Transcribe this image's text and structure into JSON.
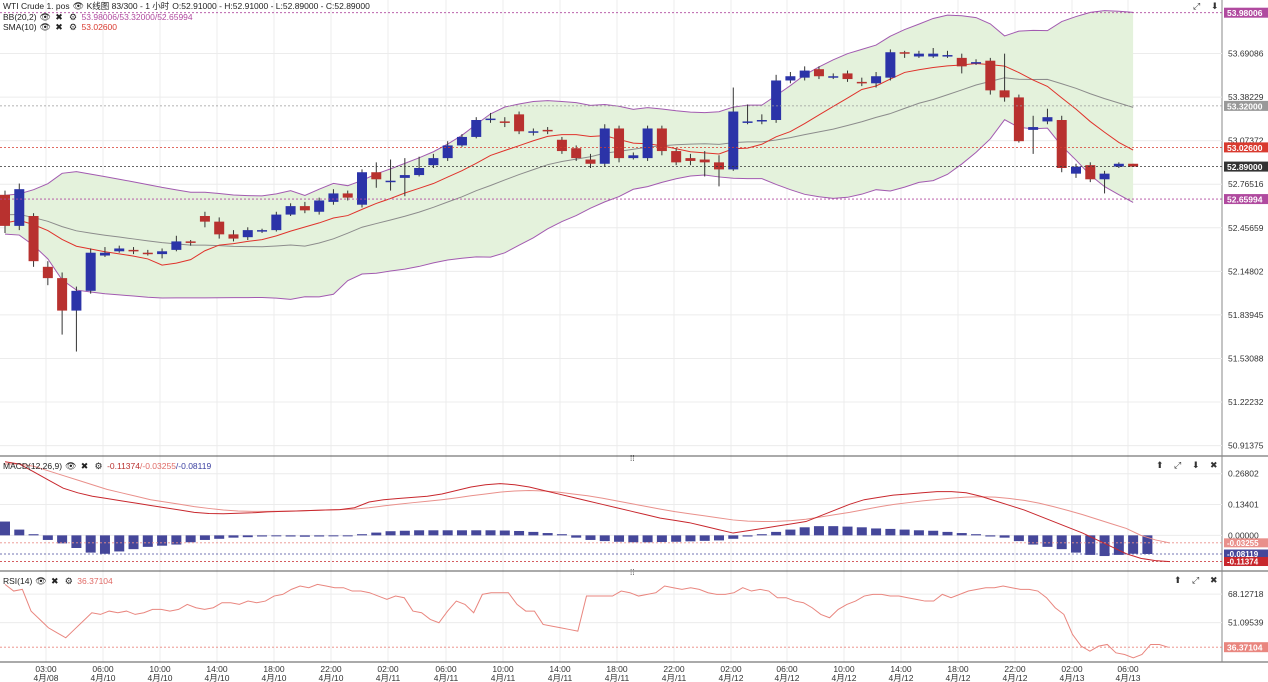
{
  "header": {
    "instrument": "WTI Crude 1. pos",
    "chart_label": "K线图 83/300 - 1 小时",
    "ohlc": "O:52.91000 - H:52.91000 - L:52.89000 - C:52.89000"
  },
  "indicators": {
    "bb": {
      "name": "BB(20,2)",
      "values_upper_mid": "53.98006/53.32000/",
      "values_lower": "52.65994"
    },
    "sma": {
      "name": "SMA(10)",
      "value": "53.02600"
    },
    "macd": {
      "name": "MACD(12,26,9)",
      "v1": "-0.11374",
      "v2": "/-0.03255",
      "v3": "/-0.08119"
    },
    "rsi": {
      "name": "RSI(14)",
      "value": "36.37104"
    }
  },
  "icons": {
    "eye": "eye-icon",
    "close": "close-icon",
    "gear": "gear-icon",
    "up": "arrow-up-icon",
    "expand": "expand-icon",
    "down": "arrow-down-icon",
    "splitter": "drag-handle-icon"
  },
  "colors": {
    "bull": "#2b33a8",
    "bear": "#b8312f",
    "band_fill": "#e4f2dc",
    "band_line": "#a25ab0",
    "sma": "#e0322b",
    "bb_mid": "#8c8c8c",
    "price_line": "#333333"
  },
  "chart_data": [
    {
      "type": "candlestick",
      "x_labels": [
        {
          "time": "03:00",
          "date": "4月/08"
        },
        {
          "time": "06:00",
          "date": "4月/10"
        },
        {
          "time": "10:00",
          "date": "4月/10"
        },
        {
          "time": "14:00",
          "date": "4月/10"
        },
        {
          "time": "18:00",
          "date": "4月/10"
        },
        {
          "time": "22:00",
          "date": "4月/10"
        },
        {
          "time": "02:00",
          "date": "4月/11"
        },
        {
          "time": "06:00",
          "date": "4月/11"
        },
        {
          "time": "10:00",
          "date": "4月/11"
        },
        {
          "time": "14:00",
          "date": "4月/11"
        },
        {
          "time": "18:00",
          "date": "4月/11"
        },
        {
          "time": "22:00",
          "date": "4月/11"
        },
        {
          "time": "02:00",
          "date": "4月/12"
        },
        {
          "time": "06:00",
          "date": "4月/12"
        },
        {
          "time": "10:00",
          "date": "4月/12"
        },
        {
          "time": "14:00",
          "date": "4月/12"
        },
        {
          "time": "18:00",
          "date": "4月/12"
        },
        {
          "time": "22:00",
          "date": "4月/12"
        },
        {
          "time": "02:00",
          "date": "4月/13"
        },
        {
          "time": "06:00",
          "date": "4月/13"
        }
      ],
      "y_ticks": [
        "53.69086",
        "53.38229",
        "53.07372",
        "52.76516",
        "52.45659",
        "52.14802",
        "51.83945",
        "51.53088",
        "51.22232",
        "50.91375"
      ],
      "ylim": [
        50.84,
        54.07
      ],
      "price_labels": [
        {
          "value": 53.98006,
          "text": "53.98006",
          "kind": "bb_upper"
        },
        {
          "value": 53.32,
          "text": "53.32000",
          "kind": "bb_mid"
        },
        {
          "value": 53.026,
          "text": "53.02600",
          "kind": "sma"
        },
        {
          "value": 52.89,
          "text": "52.89000",
          "kind": "last"
        },
        {
          "value": 52.65994,
          "text": "52.65994",
          "kind": "bb_lower"
        }
      ],
      "candles": [
        [
          52.69,
          52.47,
          52.72,
          52.42
        ],
        [
          52.47,
          52.73,
          52.77,
          52.44
        ],
        [
          52.54,
          52.22,
          52.56,
          52.18
        ],
        [
          52.18,
          52.1,
          52.22,
          52.05
        ],
        [
          52.1,
          51.87,
          52.14,
          51.7
        ],
        [
          51.87,
          52.01,
          52.04,
          51.58
        ],
        [
          52.01,
          52.28,
          52.31,
          51.99
        ],
        [
          52.26,
          52.28,
          52.32,
          52.25
        ],
        [
          52.29,
          52.31,
          52.33,
          52.28
        ],
        [
          52.3,
          52.29,
          52.32,
          52.27
        ],
        [
          52.28,
          52.27,
          52.3,
          52.26
        ],
        [
          52.27,
          52.29,
          52.31,
          52.24
        ],
        [
          52.3,
          52.36,
          52.4,
          52.29
        ],
        [
          52.36,
          52.35,
          52.37,
          52.33
        ],
        [
          52.54,
          52.5,
          52.57,
          52.46
        ],
        [
          52.5,
          52.41,
          52.53,
          52.38
        ],
        [
          52.41,
          52.38,
          52.44,
          52.36
        ],
        [
          52.39,
          52.44,
          52.46,
          52.37
        ],
        [
          52.44,
          52.44,
          52.45,
          52.42
        ],
        [
          52.44,
          52.55,
          52.57,
          52.43
        ],
        [
          52.55,
          52.61,
          52.63,
          52.54
        ],
        [
          52.61,
          52.58,
          52.64,
          52.56
        ],
        [
          52.57,
          52.65,
          52.67,
          52.55
        ],
        [
          52.64,
          52.7,
          52.73,
          52.62
        ],
        [
          52.7,
          52.67,
          52.72,
          52.65
        ],
        [
          52.62,
          52.85,
          52.87,
          52.6
        ],
        [
          52.85,
          52.8,
          52.92,
          52.74
        ],
        [
          52.79,
          52.79,
          52.94,
          52.72
        ],
        [
          52.81,
          52.83,
          52.95,
          52.68
        ],
        [
          52.83,
          52.88,
          52.96,
          52.82
        ],
        [
          52.9,
          52.95,
          52.98,
          52.88
        ],
        [
          52.95,
          53.04,
          53.07,
          52.93
        ],
        [
          53.04,
          53.1,
          53.12,
          53.03
        ],
        [
          53.1,
          53.22,
          53.24,
          53.09
        ],
        [
          53.22,
          53.23,
          53.27,
          53.2
        ],
        [
          53.21,
          53.2,
          53.24,
          53.17
        ],
        [
          53.26,
          53.14,
          53.28,
          53.12
        ],
        [
          53.14,
          53.14,
          53.16,
          53.11
        ],
        [
          53.15,
          53.14,
          53.17,
          53.12
        ],
        [
          53.08,
          53.0,
          53.1,
          52.98
        ],
        [
          53.02,
          52.95,
          53.04,
          52.93
        ],
        [
          52.94,
          52.91,
          52.98,
          52.88
        ],
        [
          52.91,
          53.16,
          53.19,
          52.89
        ],
        [
          53.16,
          52.95,
          53.18,
          52.92
        ],
        [
          52.95,
          52.97,
          52.99,
          52.94
        ],
        [
          52.95,
          53.16,
          53.18,
          52.93
        ],
        [
          53.16,
          53.0,
          53.18,
          52.97
        ],
        [
          53.0,
          52.92,
          53.02,
          52.9
        ],
        [
          52.95,
          52.93,
          52.98,
          52.9
        ],
        [
          52.94,
          52.92,
          53.0,
          52.82
        ],
        [
          52.92,
          52.87,
          52.97,
          52.75
        ],
        [
          52.87,
          53.28,
          53.45,
          52.86
        ],
        [
          53.2,
          53.21,
          53.33,
          53.19
        ],
        [
          53.21,
          53.22,
          53.26,
          53.19
        ],
        [
          53.22,
          53.5,
          53.54,
          53.2
        ],
        [
          53.5,
          53.53,
          53.56,
          53.48
        ],
        [
          53.52,
          53.57,
          53.6,
          53.5
        ],
        [
          53.58,
          53.53,
          53.6,
          53.51
        ],
        [
          53.53,
          53.53,
          53.55,
          53.51
        ],
        [
          53.55,
          53.51,
          53.57,
          53.49
        ],
        [
          53.49,
          53.48,
          53.52,
          53.46
        ],
        [
          53.48,
          53.53,
          53.56,
          53.45
        ],
        [
          53.52,
          53.7,
          53.72,
          53.5
        ],
        [
          53.7,
          53.69,
          53.71,
          53.66
        ],
        [
          53.67,
          53.69,
          53.71,
          53.66
        ],
        [
          53.67,
          53.69,
          53.73,
          53.66
        ],
        [
          53.68,
          53.68,
          53.71,
          53.66
        ],
        [
          53.66,
          53.6,
          53.69,
          53.55
        ],
        [
          53.62,
          53.63,
          53.65,
          53.61
        ],
        [
          53.64,
          53.43,
          53.66,
          53.4
        ],
        [
          53.43,
          53.38,
          53.69,
          53.35
        ],
        [
          53.38,
          53.07,
          53.4,
          53.06
        ],
        [
          53.15,
          53.17,
          53.25,
          52.98
        ],
        [
          53.21,
          53.24,
          53.3,
          53.19
        ],
        [
          53.22,
          52.88,
          53.25,
          52.85
        ],
        [
          52.84,
          52.89,
          52.91,
          52.81
        ],
        [
          52.9,
          52.8,
          52.92,
          52.78
        ],
        [
          52.8,
          52.84,
          52.86,
          52.7
        ],
        [
          52.89,
          52.91,
          52.92,
          52.88
        ],
        [
          52.91,
          52.89,
          52.91,
          52.89
        ]
      ]
    },
    {
      "type": "macd",
      "name": "MACD(12,26,9)",
      "y_ticks": [
        "0.26802",
        "0.13401",
        "0.00000"
      ],
      "ylim": [
        -0.155,
        0.345
      ],
      "price_labels": [
        {
          "value": -0.03255,
          "text": "-0.03255"
        },
        {
          "value": -0.08119,
          "text": "-0.08119"
        },
        {
          "value": -0.11374,
          "text": "-0.11374"
        }
      ],
      "histogram": [
        0.06,
        0.025,
        0.005,
        -0.02,
        -0.035,
        -0.055,
        -0.075,
        -0.08,
        -0.07,
        -0.06,
        -0.05,
        -0.045,
        -0.04,
        -0.03,
        -0.02,
        -0.015,
        -0.01,
        -0.008,
        -0.005,
        -0.004,
        -0.005,
        -0.006,
        -0.005,
        -0.004,
        -0.003,
        0.005,
        0.012,
        0.018,
        0.02,
        0.022,
        0.022,
        0.022,
        0.022,
        0.022,
        0.022,
        0.021,
        0.019,
        0.015,
        0.01,
        0.005,
        -0.01,
        -0.02,
        -0.025,
        -0.028,
        -0.03,
        -0.03,
        -0.029,
        -0.028,
        -0.026,
        -0.024,
        -0.022,
        -0.015,
        -0.005,
        0.005,
        0.015,
        0.025,
        0.035,
        0.04,
        0.04,
        0.038,
        0.035,
        0.03,
        0.028,
        0.025,
        0.022,
        0.02,
        0.015,
        0.01,
        0.005,
        -0.005,
        -0.01,
        -0.025,
        -0.04,
        -0.05,
        -0.06,
        -0.075,
        -0.085,
        -0.09,
        -0.085,
        -0.08,
        -0.081
      ],
      "macd_line": [
        0.32,
        0.31,
        0.275,
        0.24,
        0.205,
        0.185,
        0.17,
        0.16,
        0.15,
        0.14,
        0.13,
        0.12,
        0.11,
        0.1,
        0.095,
        0.094,
        0.096,
        0.098,
        0.102,
        0.104,
        0.106,
        0.108,
        0.11,
        0.112,
        0.12,
        0.145,
        0.155,
        0.16,
        0.165,
        0.17,
        0.18,
        0.195,
        0.21,
        0.22,
        0.225,
        0.22,
        0.21,
        0.195,
        0.18,
        0.165,
        0.15,
        0.135,
        0.12,
        0.105,
        0.09,
        0.075,
        0.065,
        0.055,
        0.04,
        0.025,
        0.01,
        0.02,
        0.03,
        0.04,
        0.05,
        0.06,
        0.085,
        0.11,
        0.135,
        0.155,
        0.165,
        0.175,
        0.18,
        0.185,
        0.19,
        0.19,
        0.185,
        0.17,
        0.15,
        0.13,
        0.11,
        0.085,
        0.06,
        0.035,
        0.01,
        -0.02,
        -0.05,
        -0.08,
        -0.1,
        -0.11,
        -0.114
      ],
      "signal_line": [
        0.31,
        0.31,
        0.3,
        0.28,
        0.26,
        0.24,
        0.22,
        0.2,
        0.185,
        0.17,
        0.155,
        0.145,
        0.135,
        0.125,
        0.117,
        0.11,
        0.106,
        0.104,
        0.104,
        0.105,
        0.106,
        0.108,
        0.11,
        0.112,
        0.114,
        0.12,
        0.128,
        0.135,
        0.142,
        0.148,
        0.155,
        0.163,
        0.172,
        0.18,
        0.188,
        0.193,
        0.195,
        0.193,
        0.188,
        0.18,
        0.172,
        0.162,
        0.15,
        0.138,
        0.126,
        0.114,
        0.103,
        0.094,
        0.085,
        0.076,
        0.067,
        0.062,
        0.06,
        0.061,
        0.064,
        0.07,
        0.08,
        0.09,
        0.1,
        0.112,
        0.124,
        0.134,
        0.142,
        0.15,
        0.156,
        0.162,
        0.166,
        0.168,
        0.166,
        0.16,
        0.152,
        0.14,
        0.125,
        0.108,
        0.09,
        0.07,
        0.05,
        0.03,
        0.0,
        -0.02,
        -0.033
      ]
    },
    {
      "type": "line",
      "name": "RSI(14)",
      "y_ticks": [
        "68.12718",
        "51.09539"
      ],
      "ylim": [
        27.5,
        82
      ],
      "price_labels": [
        {
          "value": 36.37104,
          "text": "36.37104"
        }
      ],
      "values": [
        74,
        70,
        71,
        58,
        53,
        48,
        45,
        42,
        47,
        52,
        57,
        56,
        58,
        57,
        58,
        56,
        57,
        59,
        59,
        58,
        59,
        62,
        60,
        59,
        60,
        63,
        63,
        62,
        64,
        63,
        64,
        67,
        68,
        71,
        73,
        72,
        74,
        73,
        72,
        72,
        70,
        70,
        69,
        67,
        65,
        67,
        66,
        58,
        57,
        53,
        51,
        58,
        64,
        62,
        57,
        68,
        69,
        69,
        69,
        62,
        58,
        58,
        50,
        49,
        48,
        47,
        46,
        67,
        67,
        67,
        67,
        70,
        69,
        67,
        68,
        69,
        73,
        72,
        71,
        72,
        71,
        69,
        68,
        68,
        69,
        72,
        70,
        71,
        70,
        66,
        66,
        64,
        63,
        60,
        56,
        54,
        59,
        62,
        64,
        67,
        68,
        68,
        67,
        67,
        66,
        65,
        64,
        64,
        68,
        66,
        68,
        70,
        71,
        72,
        72,
        73,
        72,
        71,
        71,
        70,
        66,
        60,
        56,
        44,
        37,
        34,
        37,
        38,
        33,
        32,
        30,
        32,
        38,
        38,
        36.37
      ]
    }
  ]
}
